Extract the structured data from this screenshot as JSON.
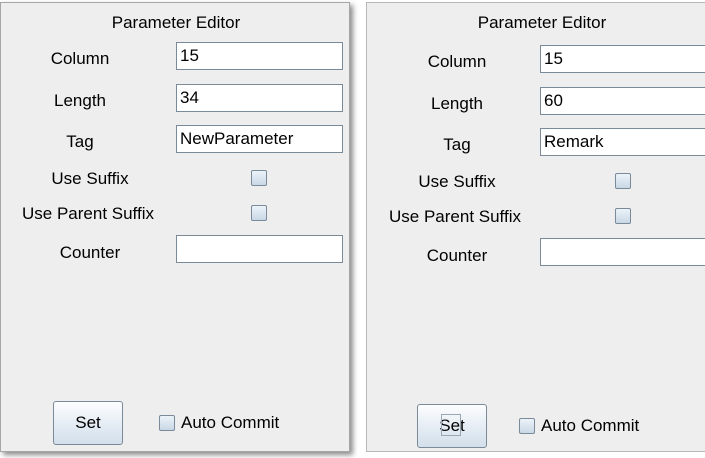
{
  "panels": [
    {
      "title": "Parameter Editor",
      "column_label": "Column",
      "column_value": "15",
      "length_label": "Length",
      "length_value": "34",
      "tag_label": "Tag",
      "tag_value": "NewParameter",
      "use_suffix_label": "Use Suffix",
      "use_parent_suffix_label": "Use Parent Suffix",
      "counter_label": "Counter",
      "counter_value": "",
      "set_label": "Set",
      "auto_commit_label": "Auto Commit"
    },
    {
      "title": "Parameter Editor",
      "column_label": "Column",
      "column_value": "15",
      "length_label": "Length",
      "length_value": "60",
      "tag_label": "Tag",
      "tag_value": "Remark",
      "use_suffix_label": "Use Suffix",
      "use_parent_suffix_label": "Use Parent Suffix",
      "counter_label": "Counter",
      "counter_value": "",
      "set_label": "Set",
      "auto_commit_label": "Auto Commit"
    }
  ]
}
